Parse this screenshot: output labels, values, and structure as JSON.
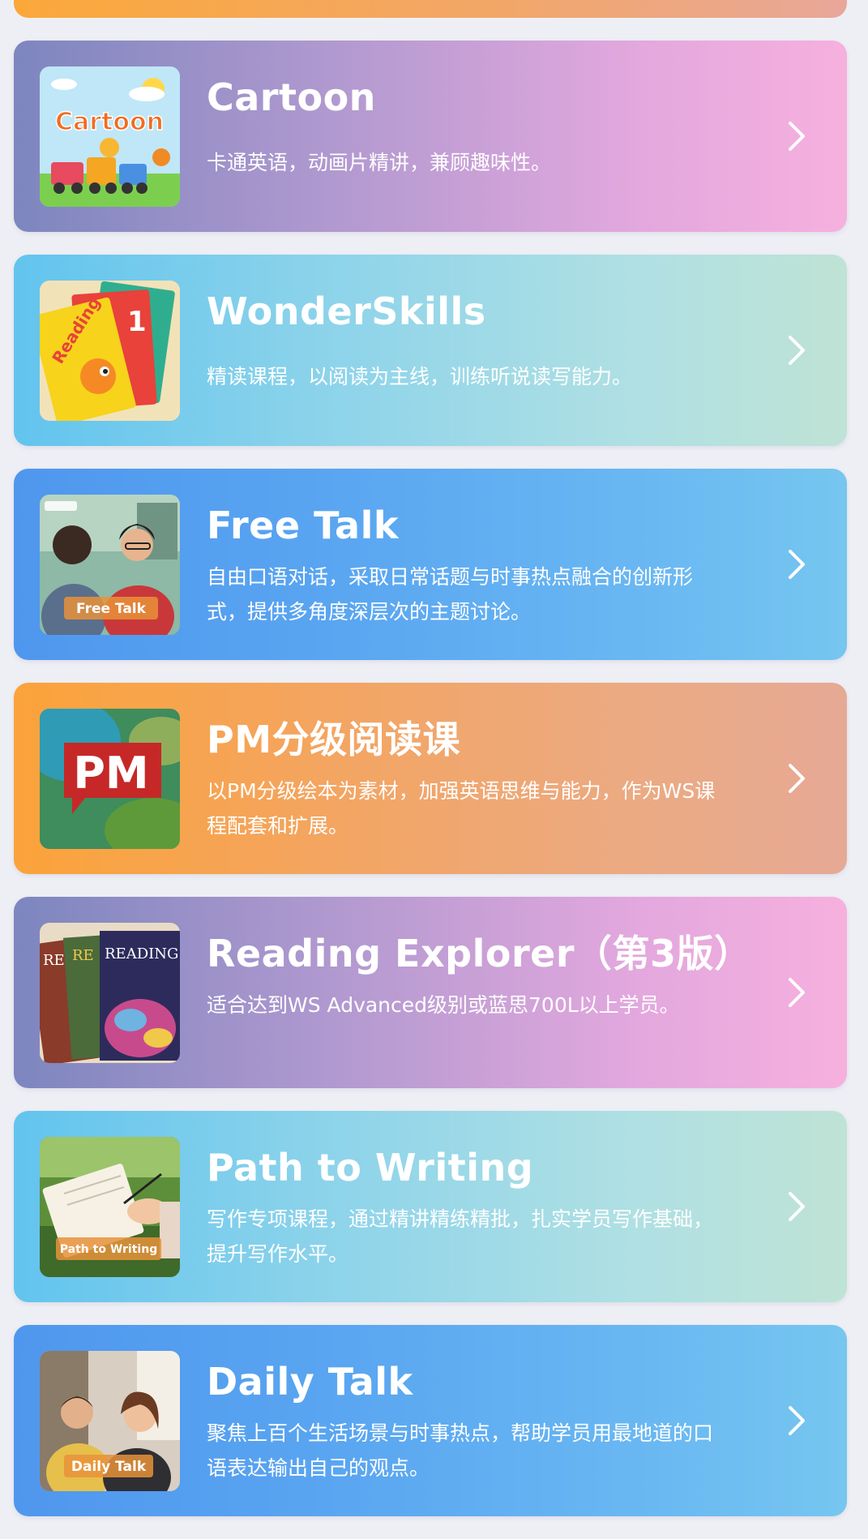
{
  "courses": [
    {
      "title": "Cartoon",
      "desc": "卡通英语，动画片精讲，兼顾趣味性。",
      "thumb_label": "Cartoon",
      "theme": "purple"
    },
    {
      "title": "WonderSkills",
      "desc": "精读课程，以阅读为主线，训练听说读写能力。",
      "thumb_label": "Reading",
      "theme": "teal"
    },
    {
      "title": "Free Talk",
      "desc": "自由口语对话，采取日常话题与时事热点融合的创新形式，提供多角度深层次的主题讨论。",
      "thumb_label": "Free Talk",
      "theme": "blue"
    },
    {
      "title": "PM分级阅读课",
      "desc": "以PM分级绘本为素材，加强英语思维与能力，作为WS课程配套和扩展。",
      "thumb_label": "PM",
      "theme": "orange"
    },
    {
      "title": "Reading Explorer（第3版）",
      "desc": "适合达到WS Advanced级别或蓝思700L以上学员。",
      "thumb_label": "READING EXPLORER",
      "theme": "purple"
    },
    {
      "title": "Path to Writing",
      "desc": "写作专项课程，通过精讲精练精批，扎实学员写作基础，提升写作水平。",
      "thumb_label": "Path to Writing",
      "theme": "teal"
    },
    {
      "title": "Daily Talk",
      "desc": "聚焦上百个生活场景与时事热点，帮助学员用最地道的口语表达输出自己的观点。",
      "thumb_label": "Daily Talk",
      "theme": "blue"
    }
  ],
  "colors": {
    "page_bg": "#eeeff5",
    "purple_start": "#7d86bf",
    "purple_end": "#f6b0de",
    "teal_start": "#62c4ee",
    "teal_end": "#bfe3d5",
    "blue_start": "#4f97ee",
    "blue_end": "#76c6f0",
    "orange_start": "#fba33a",
    "orange_end": "#e6a995",
    "text": "#ffffff"
  },
  "icons": {
    "chevron": "chevron-right-icon"
  }
}
